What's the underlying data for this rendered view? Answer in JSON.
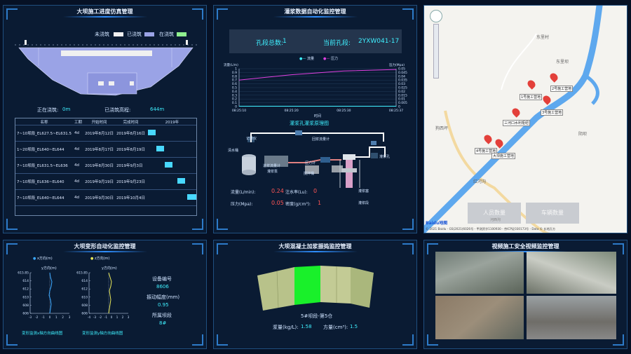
{
  "panels": {
    "dam_progress": {
      "title": "大坝施工进度仿真管理",
      "legend": [
        {
          "label": "未浇筑",
          "color": "#f0f0f0"
        },
        {
          "label": "已浇筑",
          "color": "#9aa3e6"
        },
        {
          "label": "在浇筑",
          "color": "#8ff08f"
        }
      ],
      "status_pouring_label": "正在浇筑:",
      "status_pouring_value": "0m",
      "status_poured_label": "已浇筑高程:",
      "status_poured_value": "644m",
      "table_headers": [
        "名称",
        "工期",
        "开始时间",
        "完成时间",
        "2019年"
      ],
      "rows": [
        {
          "name": "7~10坝段_EL627.5~EL631.5",
          "days": "4d",
          "start": "2019年8月12日",
          "end": "2019年8月16日",
          "bar_start": 0.0,
          "bar_len": 0.16
        },
        {
          "name": "1~20坝段_EL640~EL644",
          "days": "4d",
          "start": "2019年8月17日",
          "end": "2019年8月19日",
          "bar_start": 0.17,
          "bar_len": 0.16
        },
        {
          "name": "7~10坝段_EL631.5~EL636",
          "days": "4d",
          "start": "2019年8月30日",
          "end": "2019年9月3日",
          "bar_start": 0.34,
          "bar_len": 0.16
        },
        {
          "name": "7~10坝段_EL636~EL640",
          "days": "4d",
          "start": "2019年9月19日",
          "end": "2019年9月23日",
          "bar_start": 0.6,
          "bar_len": 0.16
        },
        {
          "name": "7~10坝段_EL640~EL644",
          "days": "4d",
          "start": "2019年9月30日",
          "end": "2019年10月4日",
          "bar_start": 0.8,
          "bar_len": 0.18
        }
      ]
    },
    "grouting": {
      "title": "灌浆数据自动化监控管理",
      "hole_total_label": "孔段总数:",
      "hole_total_value": "1",
      "hole_current_label": "当前孔段:",
      "hole_current_value": "2YXW041-17",
      "legend": [
        {
          "label": "流量",
          "color": "#3ff0ff"
        },
        {
          "label": "压力",
          "color": "#e040e0"
        }
      ],
      "y_left_label": "流量(L/m)",
      "y_right_label": "压力(Mpa)",
      "x_label": "时间",
      "y_left_ticks": [
        "1",
        "0.9",
        "0.8",
        "0.7",
        "0.6",
        "0.5",
        "0.4",
        "0.3",
        "0.2",
        "0.1",
        "0"
      ],
      "y_right_ticks": [
        "0.05",
        "0.045",
        "0.04",
        "0.035",
        "0.03",
        "0.025",
        "0.02",
        "0.015",
        "0.01",
        "0.005",
        "0"
      ],
      "x_ticks": [
        "08:25:10",
        "08:25:20",
        "08:25:30",
        "08:25:37"
      ],
      "flow_series": [
        0.01,
        0.01,
        0.01,
        0.01
      ],
      "pressure_series": [
        0.035,
        0.042,
        0.047,
        0.049
      ],
      "diagram_title": "灌浆孔灌浆原理图",
      "diagram_labels": [
        "清水桶",
        "灌浆泵",
        "回浆流量计",
        "进浆流量计",
        "压力计",
        "灌浆孔",
        "搅拌桶",
        "灌浆塞",
        "灌浆段",
        "记录仪"
      ],
      "readings": [
        {
          "label": "流量(L/min):",
          "value": "0.24"
        },
        {
          "label": "注水率(Lu):",
          "value": "0"
        },
        {
          "label": "压力(Mpa):",
          "value": "0.05"
        },
        {
          "label": "密度(g/cm³):",
          "value": "1"
        }
      ]
    },
    "map": {
      "markers": [
        {
          "label": "1号施工营地"
        },
        {
          "label": "2号施工营地"
        },
        {
          "label": "3号施工营地"
        },
        {
          "label": "三河口水利枢纽"
        },
        {
          "label": "4号施工营地"
        },
        {
          "label": "大坝施工营地"
        }
      ],
      "place_labels": [
        "东里村",
        "东里坝",
        "狗西坪",
        "阴坝",
        "红河沟"
      ],
      "btn_people": "人员数量",
      "btn_people_sub": "河西沟",
      "btn_vehicles": "车辆数量",
      "copyright": "© 2021 Baidu - GS(2021)6026号 - 甲测资字1100930 - 京ICP证030173号 - Data © 长地万方",
      "logo": "Baidu地图"
    },
    "deformation": {
      "title": "大坝变形自动化监控管理",
      "chart_left": {
        "legend": "x方向(m)",
        "y_label": "y方向(m)",
        "color": "#3aa8ff",
        "caption": "变形监测x轴方向曲线图",
        "x_ticks": [
          "-3",
          "-2",
          "-1",
          "0",
          "1",
          "2",
          "3"
        ]
      },
      "chart_right": {
        "legend": "z方向(m)",
        "y_label": "y方向(m)",
        "color": "#e8e85a",
        "caption": "变形监测y轴方向曲线图",
        "x_ticks": [
          "-4",
          "-3",
          "-2",
          "-1",
          "0",
          "1",
          "2",
          "3"
        ]
      },
      "y_ticks_left": [
        "615.85",
        "614",
        "612",
        "610",
        "608",
        "606"
      ],
      "y_ticks_right": [
        "615.85",
        "614",
        "612",
        "610",
        "608",
        "606"
      ],
      "device_label": "设备编号",
      "device_value": "8606",
      "amp_label": "振动幅度(mm)",
      "amp_value": "0.95",
      "section_label": "所属坝段",
      "section_value": "8#"
    },
    "concrete": {
      "title": "大坝混凝土加浆振捣监控管理",
      "section": "5#坝段-第5仓",
      "dosage_label": "浆量(kg/L):",
      "dosage_value": "1.58",
      "volume_label": "方量(cm³):",
      "volume_value": "1.5"
    },
    "video": {
      "title": "视频施工安全视频监控管理"
    }
  }
}
